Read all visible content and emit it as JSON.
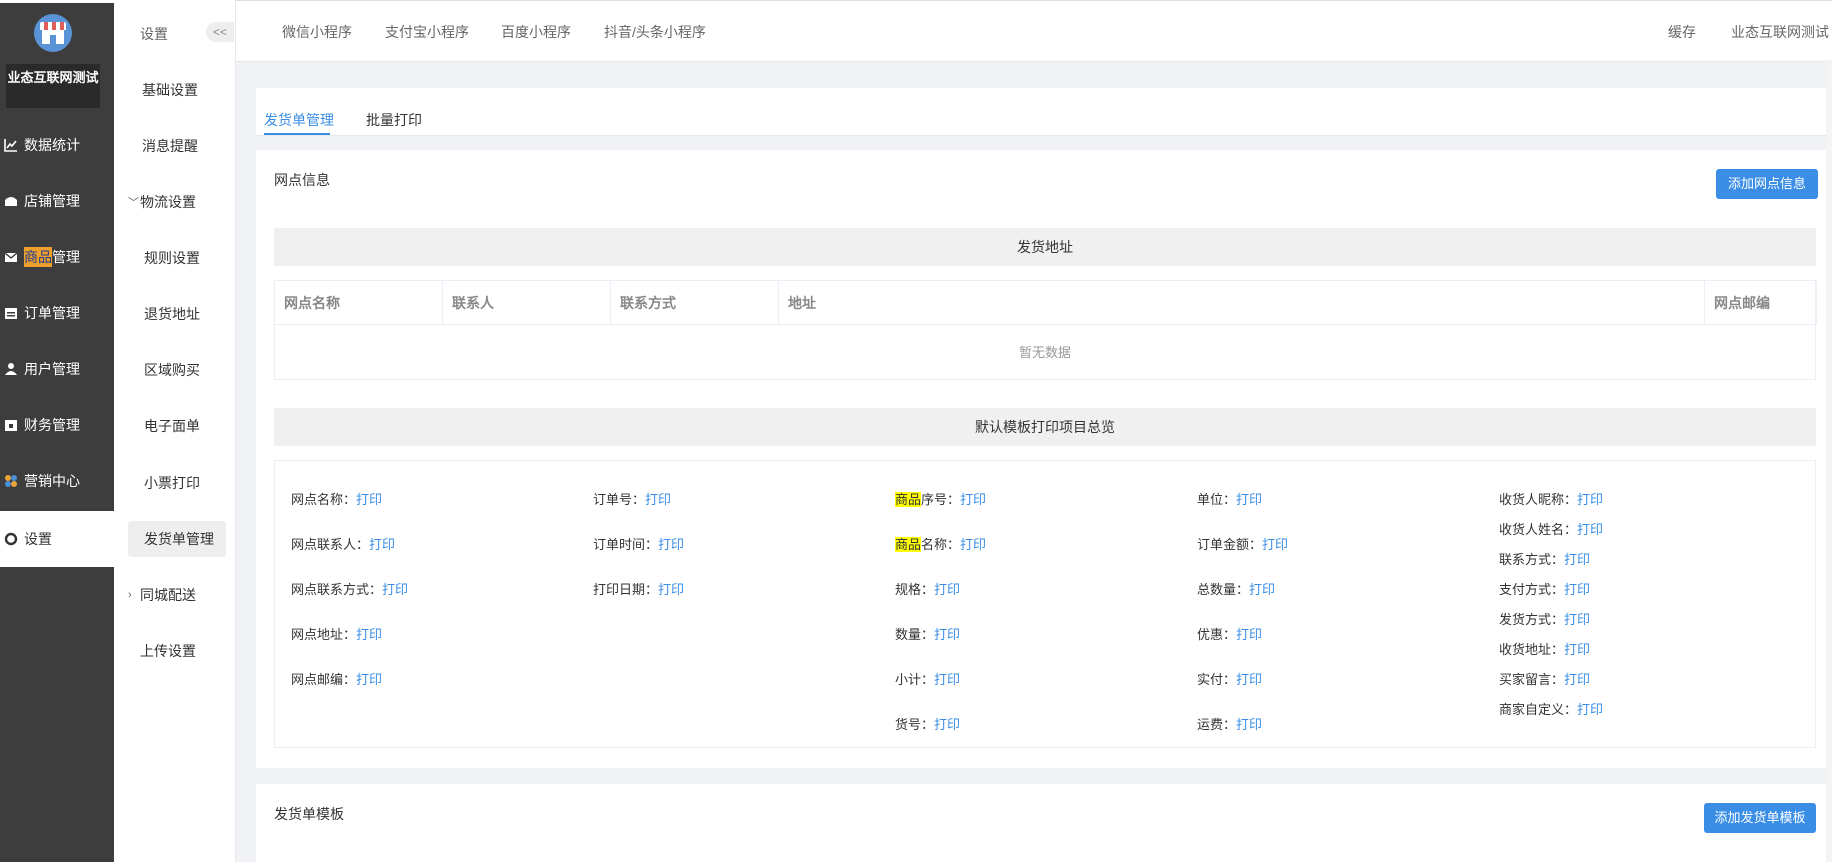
{
  "brand": {
    "name": "业态互联网测试"
  },
  "sidebar": {
    "items": [
      {
        "label": "数据统计",
        "icon": "chart-line-icon"
      },
      {
        "label": "店铺管理",
        "icon": "store-icon"
      },
      {
        "label_hl": "商品",
        "label_rest": "管理",
        "icon": "mail-icon"
      },
      {
        "label": "订单管理",
        "icon": "calendar-icon"
      },
      {
        "label": "用户管理",
        "icon": "user-icon"
      },
      {
        "label": "财务管理",
        "icon": "wallet-icon"
      },
      {
        "label": "营销中心",
        "icon": "marketing-icon"
      },
      {
        "label": "设置",
        "icon": "gear-icon",
        "active": true
      }
    ]
  },
  "subnav": {
    "title": "设置",
    "collapse": "<<",
    "items": [
      {
        "label": "基础设置"
      },
      {
        "label": "消息提醒"
      },
      {
        "label": "物流设置",
        "arrow": "﹀"
      },
      {
        "label": "规则设置"
      },
      {
        "label": "退货地址"
      },
      {
        "label": "区域购买"
      },
      {
        "label": "电子面单"
      },
      {
        "label": "小票打印"
      },
      {
        "label": "发货单管理"
      },
      {
        "label": "同城配送",
        "arrow": "›"
      },
      {
        "label": "上传设置"
      }
    ]
  },
  "topbar": {
    "tabs": [
      "微信小程序",
      "支付宝小程序",
      "百度小程序",
      "抖音/头条小程序"
    ],
    "cache": "缓存",
    "user": "业态互联网测试"
  },
  "content_tabs": [
    "发货单管理",
    "批量打印"
  ],
  "outlet": {
    "title": "网点信息",
    "add_button": "添加网点信息",
    "address_bar": "发货地址",
    "columns": [
      "网点名称",
      "联系人",
      "联系方式",
      "地址",
      "网点邮编"
    ],
    "empty_text": "暂无数据"
  },
  "template_preview": {
    "title": "默认模板打印项目总览",
    "link": "打印",
    "col1": [
      "网点名称：",
      "网点联系人：",
      "网点联系方式：",
      "网点地址：",
      "网点邮编："
    ],
    "col2": [
      "订单号：",
      "订单时间：",
      "打印日期："
    ],
    "col3_hl": [
      "商品",
      "商品"
    ],
    "col3_rest": [
      "序号：",
      "名称："
    ],
    "col3": [
      "规格：",
      "数量：",
      "小计：",
      "货号："
    ],
    "col4": [
      "单位：",
      "订单金额：",
      "总数量：",
      "优惠：",
      "实付：",
      "运费："
    ],
    "col5": [
      "收货人昵称：",
      "收货人姓名：",
      "联系方式：",
      "支付方式：",
      "发货方式：",
      "收货地址：",
      "买家留言：",
      "商家自定义："
    ]
  },
  "invoice_template": {
    "title": "发货单模板",
    "add_button": "添加发货单模板"
  },
  "colors": {
    "accent": "#3a8ee6",
    "sidebar_bg": "#3d3d3d",
    "highlight_orange": "#f0a02a",
    "highlight_yellow": "#ffff00"
  }
}
